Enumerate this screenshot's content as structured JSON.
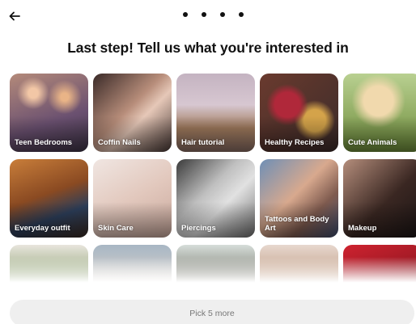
{
  "header": {
    "back_icon": "arrow-left-icon",
    "progress_dots": 4,
    "title": "Last step! Tell us what you're interested in"
  },
  "topics": [
    {
      "label": "Teen Bedrooms"
    },
    {
      "label": "Coffin Nails"
    },
    {
      "label": "Hair tutorial"
    },
    {
      "label": "Healthy Recipes"
    },
    {
      "label": "Cute Animals"
    },
    {
      "label": "Everyday outfit"
    },
    {
      "label": "Skin Care"
    },
    {
      "label": "Piercings"
    },
    {
      "label": "Tattoos and Body Art"
    },
    {
      "label": "Makeup"
    },
    {
      "label": ""
    },
    {
      "label": ""
    },
    {
      "label": ""
    },
    {
      "label": ""
    },
    {
      "label": ""
    }
  ],
  "footer": {
    "button_label": "Pick 5 more"
  },
  "colors": {
    "button_bg": "#efefef",
    "button_text": "#777777",
    "text": "#111111"
  }
}
